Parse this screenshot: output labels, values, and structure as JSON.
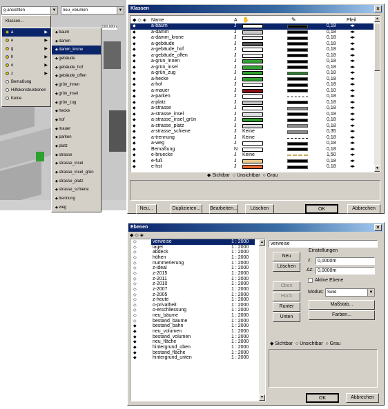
{
  "toolbar": {
    "group_select": "g-ansichten",
    "layer_select": "neu_volumen",
    "scale_label": "500,000m"
  },
  "left_menu": {
    "header_item": "Klassen...",
    "items": [
      {
        "label": "a",
        "dot": "#d4c400",
        "sub": true
      },
      {
        "label": "e",
        "dot": "#d4c400",
        "sub": true
      },
      {
        "label": "g",
        "dot": "#d4c400",
        "sub": true
      },
      {
        "label": "h",
        "dot": "#d4c400",
        "sub": true
      },
      {
        "label": "o",
        "dot": "#d4c400",
        "sub": true
      },
      {
        "label": "z",
        "dot": "#d4c400",
        "sub": true
      },
      {
        "label": "Bemaßung",
        "dot": "#ffffff"
      },
      {
        "label": "Hilfskonstruktionen",
        "dot": "#ffffff"
      },
      {
        "label": "Keine",
        "dot": "#ffffff"
      }
    ]
  },
  "sub_menu": {
    "items": [
      "baum",
      "damm",
      "damm_krone",
      "gebäude",
      "gebäude_hof",
      "gebäude_offen",
      "grün_innen",
      "grün_insel",
      "grün_zug",
      "hecke",
      "hof",
      "mauer",
      "parken",
      "platz",
      "strasse",
      "strasse_insel",
      "strasse_insel_grün",
      "strasse_platz",
      "strasse_schiene",
      "trennung",
      "weg"
    ]
  },
  "klassen": {
    "title": "Klassen",
    "headers": {
      "name": "Name",
      "a": "A",
      "pfeil": "Pfeil"
    },
    "rows": [
      {
        "name": "a-baum",
        "a": "J",
        "fill": "#ffffff",
        "fill_text": "",
        "line": "solid",
        "w": "0,18"
      },
      {
        "name": "a-damm",
        "a": "J",
        "fill": "#c8c8c8",
        "fill_text": "",
        "line": "solid",
        "w": "0,18"
      },
      {
        "name": "a-damm_krone",
        "a": "J",
        "fill": "#e8e8e8",
        "fill_text": "",
        "line": "solid",
        "w": "0,18"
      },
      {
        "name": "a-gebäude",
        "a": "J",
        "fill": "#5a5a5a",
        "fill_text": "",
        "line": "solid",
        "w": "0,18"
      },
      {
        "name": "a-gebäude_hof",
        "a": "J",
        "fill": "#ffffff",
        "fill_text": "",
        "line": "solid",
        "w": "0,18"
      },
      {
        "name": "a-gebäude_offen",
        "a": "J",
        "fill": "#ffffff",
        "fill_text": "",
        "line": "solid",
        "w": "0,18"
      },
      {
        "name": "a-grün_innen",
        "a": "J",
        "fill": "#30a030",
        "fill_text": "",
        "line": "solid",
        "w": "0,18"
      },
      {
        "name": "a-grün_insel",
        "a": "J",
        "fill": "#30a030",
        "fill_text": "",
        "line": "solid",
        "w": "0,18"
      },
      {
        "name": "a-grün_zug",
        "a": "J",
        "fill": "#30a030",
        "fill_text": "",
        "line": "green",
        "w": "0,18"
      },
      {
        "name": "a-hecke",
        "a": "J",
        "fill": "#30a030",
        "fill_text": "",
        "line": "solid",
        "w": "0,18"
      },
      {
        "name": "a-hof",
        "a": "J",
        "fill": "#ffffff",
        "fill_text": "",
        "line": "solid",
        "w": "0,18"
      },
      {
        "name": "a-mauer",
        "a": "J",
        "fill": "#8b1010",
        "fill_text": "",
        "line": "solid",
        "w": "0,10"
      },
      {
        "name": "a-parken",
        "a": "J",
        "fill": "#ffffff",
        "fill_text": "",
        "line": "dashed",
        "w": "0,18"
      },
      {
        "name": "a-platz",
        "a": "J",
        "fill": "#c0c0c0",
        "fill_text": "",
        "line": "solid",
        "w": "0,18"
      },
      {
        "name": "a-strasse",
        "a": "J",
        "fill": "#ffffff",
        "fill_text": "",
        "line": "gray",
        "w": "0,18"
      },
      {
        "name": "a-strasse_insel",
        "a": "J",
        "fill": "#e0e0e0",
        "fill_text": "",
        "line": "solid",
        "w": "0,18"
      },
      {
        "name": "a-strasse_insel_grün",
        "a": "J",
        "fill": "#30a030",
        "fill_text": "",
        "line": "solid",
        "w": "0,18"
      },
      {
        "name": "a-strasse_platz",
        "a": "J",
        "fill": "#d8d8d8",
        "fill_text": "",
        "line": "gray",
        "w": "0,18"
      },
      {
        "name": "a-strasse_schiene",
        "a": "J",
        "fill": "",
        "fill_text": "Keine",
        "line": "gray",
        "w": "0,35"
      },
      {
        "name": "a-trennung",
        "a": "J",
        "fill": "",
        "fill_text": "Keine",
        "line": "dashed",
        "w": "0,18"
      },
      {
        "name": "a-weg",
        "a": "J",
        "fill": "#ffffff",
        "fill_text": "",
        "line": "solid",
        "w": "0,18"
      },
      {
        "name": "Bemaßung",
        "a": "N",
        "fill": "#ffffff",
        "fill_text": "",
        "line": "solid",
        "w": "0,18"
      },
      {
        "name": "e-bruecke",
        "a": "J",
        "fill": "",
        "fill_text": "Keine",
        "line": "tan-dashed",
        "w": "1,50"
      },
      {
        "name": "e-fuß",
        "a": "J",
        "fill": "#e8c890",
        "fill_text": "",
        "line": "solid",
        "w": "0,18"
      },
      {
        "name": "e-hst",
        "a": "J",
        "fill": "#e86a30",
        "fill_text": "",
        "line": "solid",
        "w": "0,18"
      }
    ],
    "radio_visible": "Sichtbar",
    "radio_invisible": "Unsichtbar",
    "radio_gray": "Grau",
    "btn_new": "Neu...",
    "btn_duplicate": "Duplizieren...",
    "btn_edit": "Bearbeiten...",
    "btn_delete": "Löschen",
    "btn_ok": "OK",
    "btn_cancel": "Abbrechen"
  },
  "ebenen": {
    "title": "Ebenen",
    "rows": [
      {
        "name": "verweise",
        "scale": "1 : 2000",
        "mark": "◇"
      },
      {
        "name": "lager",
        "scale": "1 : 2000",
        "mark": "◇"
      },
      {
        "name": "abdeck",
        "scale": "1 : 2000",
        "mark": "◇"
      },
      {
        "name": "höhen",
        "scale": "1 : 2000",
        "mark": "◇"
      },
      {
        "name": "nummerierung",
        "scale": "1 : 2000",
        "mark": "◇"
      },
      {
        "name": "z-ideal",
        "scale": "1 : 2000",
        "mark": "◇"
      },
      {
        "name": "z-2015",
        "scale": "1 : 2000",
        "mark": "◇"
      },
      {
        "name": "z-2011",
        "scale": "1 : 2000",
        "mark": "◇"
      },
      {
        "name": "z-2010",
        "scale": "1 : 2000",
        "mark": "◇"
      },
      {
        "name": "z-2007",
        "scale": "1 : 2000",
        "mark": "◇"
      },
      {
        "name": "z-2005",
        "scale": "1 : 2000",
        "mark": "◇"
      },
      {
        "name": "z-heute",
        "scale": "1 : 2000",
        "mark": "◇"
      },
      {
        "name": "o-privatheit",
        "scale": "1 : 2000",
        "mark": "◇"
      },
      {
        "name": "o-erschliessung",
        "scale": "1 : 2000",
        "mark": "◇"
      },
      {
        "name": "neu_bäume",
        "scale": "1 : 2000",
        "mark": "◇"
      },
      {
        "name": "bestand_bäume",
        "scale": "1 : 2000",
        "mark": "◇"
      },
      {
        "name": "bestand_bahn",
        "scale": "1 : 2000",
        "mark": "◆"
      },
      {
        "name": "neu_volumen",
        "scale": "1 : 2000",
        "mark": "◆"
      },
      {
        "name": "bestand_volumen",
        "scale": "1 : 2000",
        "mark": "◆"
      },
      {
        "name": "neu_fläche",
        "scale": "1 : 2000",
        "mark": "◆"
      },
      {
        "name": "hintergrund_oben",
        "scale": "1 : 2000",
        "mark": "◆"
      },
      {
        "name": "bestand_fläche",
        "scale": "1 : 2000",
        "mark": "◆"
      },
      {
        "name": "hintergrund_unten",
        "scale": "1 : 2000",
        "mark": "◆"
      }
    ],
    "name_value": "verweise",
    "btn_new": "Neu",
    "btn_delete": "Löschen",
    "btn_up": "Oben",
    "btn_top": "Hoch",
    "btn_down": "Runter",
    "btn_bottom": "Unten",
    "settings_label": "Einstellungen",
    "z_label": "z:",
    "z_value": "0,0000m",
    "dz_label": "Δz:",
    "dz_value": "0,0000m",
    "active_label": "Aktive Ebene",
    "mode_label": "Modus:",
    "mode_value": "Solid",
    "btn_scale": "Maßstab...",
    "btn_colors": "Farben...",
    "radio_visible": "Sichtbar",
    "radio_invisible": "Unsichtbar",
    "radio_gray": "Grau",
    "btn_ok": "OK",
    "btn_cancel": "Abbrechen"
  }
}
